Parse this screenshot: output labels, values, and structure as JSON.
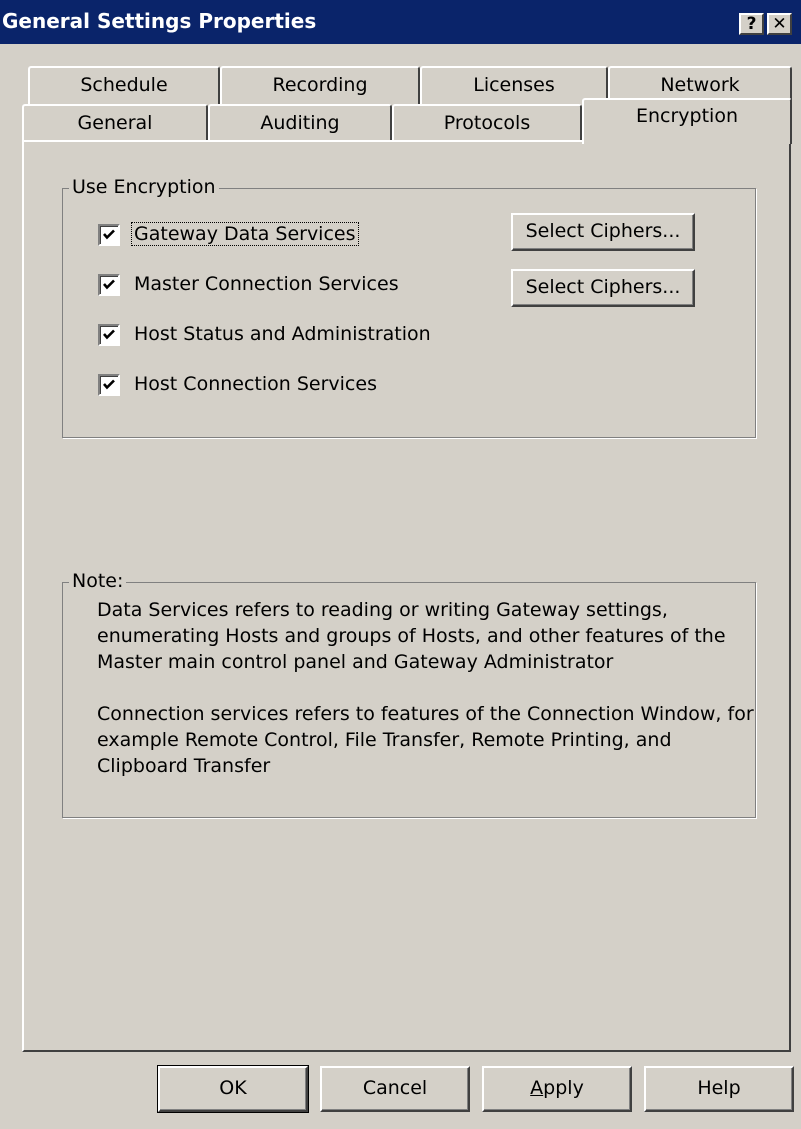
{
  "window": {
    "title": "General Settings Properties",
    "help_button": "?",
    "close_button": "✕"
  },
  "tabs": {
    "back_row": [
      "Schedule",
      "Recording",
      "Licenses",
      "Network"
    ],
    "front_row": [
      "General",
      "Auditing",
      "Protocols",
      "Encryption"
    ],
    "active": "Encryption"
  },
  "encryption_group": {
    "legend": "Use Encryption",
    "checkboxes": [
      {
        "label": "Gateway Data Services",
        "checked": true
      },
      {
        "label": "Master Connection Services",
        "checked": true
      },
      {
        "label": "Host Status and Administration",
        "checked": true
      },
      {
        "label": "Host Connection Services",
        "checked": true
      }
    ],
    "cipher_buttons": [
      "Select Ciphers...",
      "Select Ciphers..."
    ]
  },
  "note_group": {
    "legend": "Note:",
    "paragraphs": [
      "Data Services refers to reading or writing Gateway settings, enumerating Hosts and groups of Hosts, and other features of the Master main control panel and Gateway Administrator",
      "Connection services refers to features of the Connection Window, for example Remote Control, File Transfer, Remote Printing, and Clipboard Transfer"
    ]
  },
  "buttons": {
    "ok": "OK",
    "cancel": "Cancel",
    "apply_mnemonic": "A",
    "apply_rest": "pply",
    "help": "Help"
  }
}
